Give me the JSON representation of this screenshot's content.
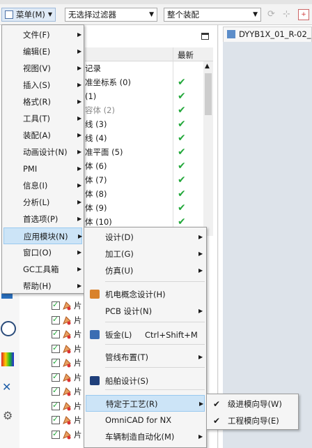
{
  "toolbar": {
    "menu_label": "菜单(M)",
    "filter_value": "无选择过滤器",
    "scope_value": "整个装配"
  },
  "graphics": {
    "tab_label": "DYYB1X_01_R-02_"
  },
  "nav": {
    "col_latest": "最新",
    "rows": [
      {
        "label": "记录",
        "checked": false,
        "grey": false
      },
      {
        "label": "准坐标系 (0)",
        "checked": true,
        "grey": false
      },
      {
        "label": "(1)",
        "checked": true,
        "grey": false
      },
      {
        "label": "容体 (2)",
        "checked": true,
        "grey": true
      },
      {
        "label": "线 (3)",
        "checked": true,
        "grey": false
      },
      {
        "label": "线 (4)",
        "checked": true,
        "grey": false
      },
      {
        "label": "准平面 (5)",
        "checked": true,
        "grey": false
      },
      {
        "label": "体 (6)",
        "checked": true,
        "grey": false
      },
      {
        "label": "体 (7)",
        "checked": true,
        "grey": false
      },
      {
        "label": "体 (8)",
        "checked": true,
        "grey": false
      },
      {
        "label": "体 (9)",
        "checked": true,
        "grey": false
      },
      {
        "label": "体 (10)",
        "checked": true,
        "grey": false
      }
    ],
    "lower_rows": [
      "片",
      "片",
      "片",
      "片",
      "片",
      "片",
      "片",
      "片",
      "片",
      "片"
    ]
  },
  "main_menu": {
    "items": [
      {
        "label": "文件(F)",
        "has_sub": true
      },
      {
        "label": "编辑(E)",
        "has_sub": true
      },
      {
        "label": "视图(V)",
        "has_sub": true
      },
      {
        "label": "插入(S)",
        "has_sub": true
      },
      {
        "label": "格式(R)",
        "has_sub": true
      },
      {
        "label": "工具(T)",
        "has_sub": true
      },
      {
        "label": "装配(A)",
        "has_sub": true
      },
      {
        "label": "动画设计(N)",
        "has_sub": true
      },
      {
        "label": "PMI",
        "has_sub": true
      },
      {
        "label": "信息(I)",
        "has_sub": true
      },
      {
        "label": "分析(L)",
        "has_sub": true
      },
      {
        "label": "首选项(P)",
        "has_sub": true
      },
      {
        "label": "应用模块(N)",
        "has_sub": true,
        "highlighted": true
      },
      {
        "label": "窗口(O)",
        "has_sub": true
      },
      {
        "label": "GC工具箱",
        "has_sub": true
      },
      {
        "label": "帮助(H)",
        "has_sub": true
      }
    ]
  },
  "app_menu": {
    "items": [
      {
        "label": "设计(D)",
        "has_sub": true
      },
      {
        "label": "加工(G)",
        "has_sub": true
      },
      {
        "label": "仿真(U)",
        "has_sub": true
      },
      {
        "label": "机电概念设计(H)",
        "has_sub": false,
        "icon": "mechatronics-icon"
      },
      {
        "label": "PCB 设计(N)",
        "has_sub": true
      },
      {
        "label": "钣金(L)",
        "shortcut": "Ctrl+Shift+M",
        "has_sub": false,
        "icon": "sheet-metal-icon"
      },
      {
        "label": "管线布置(T)",
        "has_sub": true
      },
      {
        "label": "船舶设计(S)",
        "has_sub": false,
        "icon": "ship-icon"
      },
      {
        "label": "特定于工艺(R)",
        "has_sub": true,
        "highlighted": true
      },
      {
        "label": "OmniCAD for NX",
        "has_sub": false
      },
      {
        "label": "车辆制造自动化(M)",
        "has_sub": true
      }
    ]
  },
  "process_menu": {
    "items": [
      {
        "label": "级进模向导(W)",
        "checked": true
      },
      {
        "label": "工程模向导(E)",
        "checked": true
      }
    ]
  },
  "colors": {
    "highlight_bg": "#cce4f7",
    "highlight_border": "#99c9ef",
    "check_green": "#22a83a"
  }
}
